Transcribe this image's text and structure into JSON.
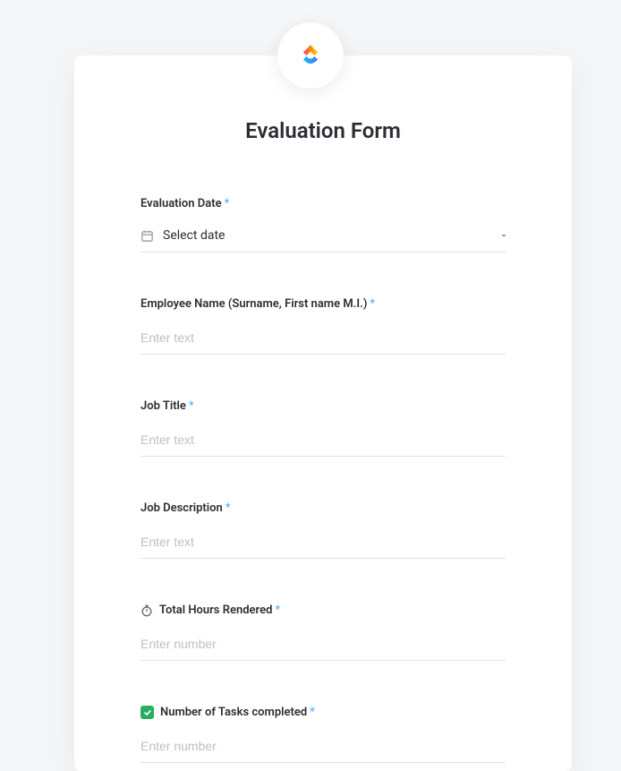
{
  "form": {
    "title": "Evaluation Form",
    "fields": {
      "evaluation_date": {
        "label": "Evaluation Date",
        "placeholder": "Select date",
        "suffix": "-"
      },
      "employee_name": {
        "label": "Employee Name (Surname, First name M.I.)",
        "placeholder": "Enter text"
      },
      "job_title": {
        "label": "Job Title",
        "placeholder": "Enter text"
      },
      "job_description": {
        "label": "Job Description",
        "placeholder": "Enter text"
      },
      "total_hours": {
        "label": "Total Hours Rendered",
        "placeholder": "Enter number"
      },
      "tasks_completed": {
        "label": "Number of Tasks completed",
        "placeholder": "Enter number"
      }
    },
    "required_mark": "*"
  }
}
